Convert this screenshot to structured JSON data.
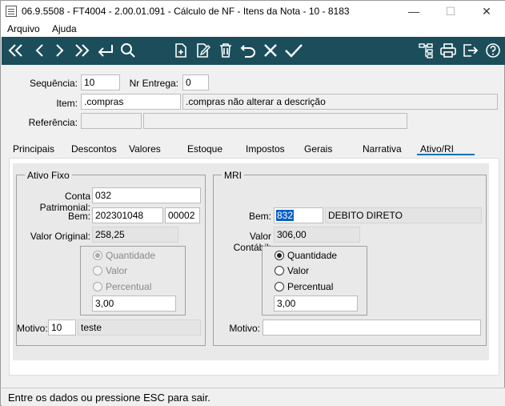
{
  "window": {
    "title": "06.9.5508 - FT4004 - 2.00.01.091 - Cálculo de NF - Itens da Nota - 10 - 8183",
    "minimize": "—",
    "maximize": "☐",
    "close": "✕"
  },
  "menu": {
    "items": [
      "Arquivo",
      "Ajuda"
    ]
  },
  "toolbar": {
    "icons": [
      "first-icon",
      "prev-icon",
      "next-icon",
      "last-icon",
      "enter-icon",
      "search-icon",
      "new-doc-icon",
      "edit-icon",
      "delete-icon",
      "undo-icon",
      "cancel-icon",
      "confirm-icon",
      "tree-icon",
      "print-icon",
      "exit-icon",
      "help-icon"
    ],
    "color": "#1b4e5a"
  },
  "header": {
    "sequencia_label": "Sequência:",
    "sequencia_value": "10",
    "nr_entrega_label": "Nr Entrega:",
    "nr_entrega_value": "0",
    "item_label": "Item:",
    "item_code": ".compras",
    "item_desc": ".compras não alterar a descrição",
    "referencia_label": "Referência:",
    "referencia_code": "",
    "referencia_desc": ""
  },
  "tabs": [
    "Principais",
    "Descontos",
    "Valores",
    "Estoque",
    "Impostos",
    "Gerais",
    "Narrativa",
    "Ativo/RI"
  ],
  "active_tab": "Ativo/RI",
  "ativo_fixo": {
    "title": "Ativo Fixo",
    "conta_label": "Conta Patrimonial:",
    "conta_value": "032",
    "bem_label": "Bem:",
    "bem_value": "202301048",
    "bem_seq": "00002",
    "valor_label": "Valor Original:",
    "valor_value": "258,25",
    "radios": [
      "Quantidade",
      "Valor",
      "Percentual"
    ],
    "selected_radio": "Quantidade",
    "quantity": "3,00",
    "motivo_label": "Motivo:",
    "motivo_code": "10",
    "motivo_desc": "teste"
  },
  "mri": {
    "title": "MRI",
    "bem_label": "Bem:",
    "bem_value": "832",
    "bem_desc": "DEBITO DIRETO",
    "valor_label": "Valor Contábil:",
    "valor_value": "306,00",
    "radios": [
      "Quantidade",
      "Valor",
      "Percentual"
    ],
    "selected_radio": "Quantidade",
    "quantity": "3,00",
    "motivo_label": "Motivo:",
    "motivo_value": ""
  },
  "status": {
    "text": "Entre os dados ou pressione ESC para sair."
  }
}
